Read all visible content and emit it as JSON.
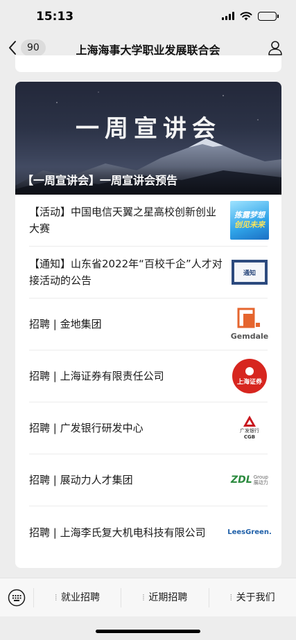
{
  "status_bar": {
    "time": "15:13"
  },
  "nav": {
    "back_count": "90",
    "title": "上海海事大学职业发展联合会"
  },
  "banner": {
    "heading": "一周宣讲会",
    "caption": "【一周宣讲会】一周宣讲会预告"
  },
  "articles": [
    {
      "title": "【活动】中国电信天翼之星高校创新创业大赛",
      "thumb": "contest-poster"
    },
    {
      "title": "【通知】山东省2022年“百校千企”人才对接活动的公告",
      "thumb": "notice-board"
    },
    {
      "title": "招聘 | 金地集团",
      "thumb": "gemdale-logo"
    },
    {
      "title": "招聘 | 上海证券有限责任公司",
      "thumb": "shanghai-securities-logo"
    },
    {
      "title": "招聘  |  广发银行研发中心",
      "thumb": "cgb-logo"
    },
    {
      "title": "招聘 | 展动力人才集团",
      "thumb": "zdl-group-logo"
    },
    {
      "title": "招聘 | 上海李氏复大机电科技有限公司",
      "thumb": "leesgreen-logo"
    }
  ],
  "thumbs": {
    "contest": {
      "line1": "拣露梦想",
      "line2": "创见未来"
    },
    "notice": {
      "text": "通知"
    },
    "gemdale": {
      "text": "Gemdale"
    },
    "securities": {
      "text": "上海证券"
    },
    "cgb": {
      "line1": "广发银行",
      "line2": "CGB"
    },
    "zdl": {
      "text": "ZDL",
      "group": "Group",
      "cn": "展动力"
    },
    "leesgreen": {
      "text": "LeesGreen."
    }
  },
  "bottom_menu": {
    "items": [
      "就业招聘",
      "近期招聘",
      "关于我们"
    ]
  },
  "colors": {
    "background": "#ededed",
    "card": "#ffffff",
    "securities_red": "#d7261f",
    "gemdale_orange": "#e5652e",
    "cgb_red": "#c8161d",
    "contest_blue": "#2fa3e8",
    "leesgreen_blue": "#1e5fa8"
  }
}
